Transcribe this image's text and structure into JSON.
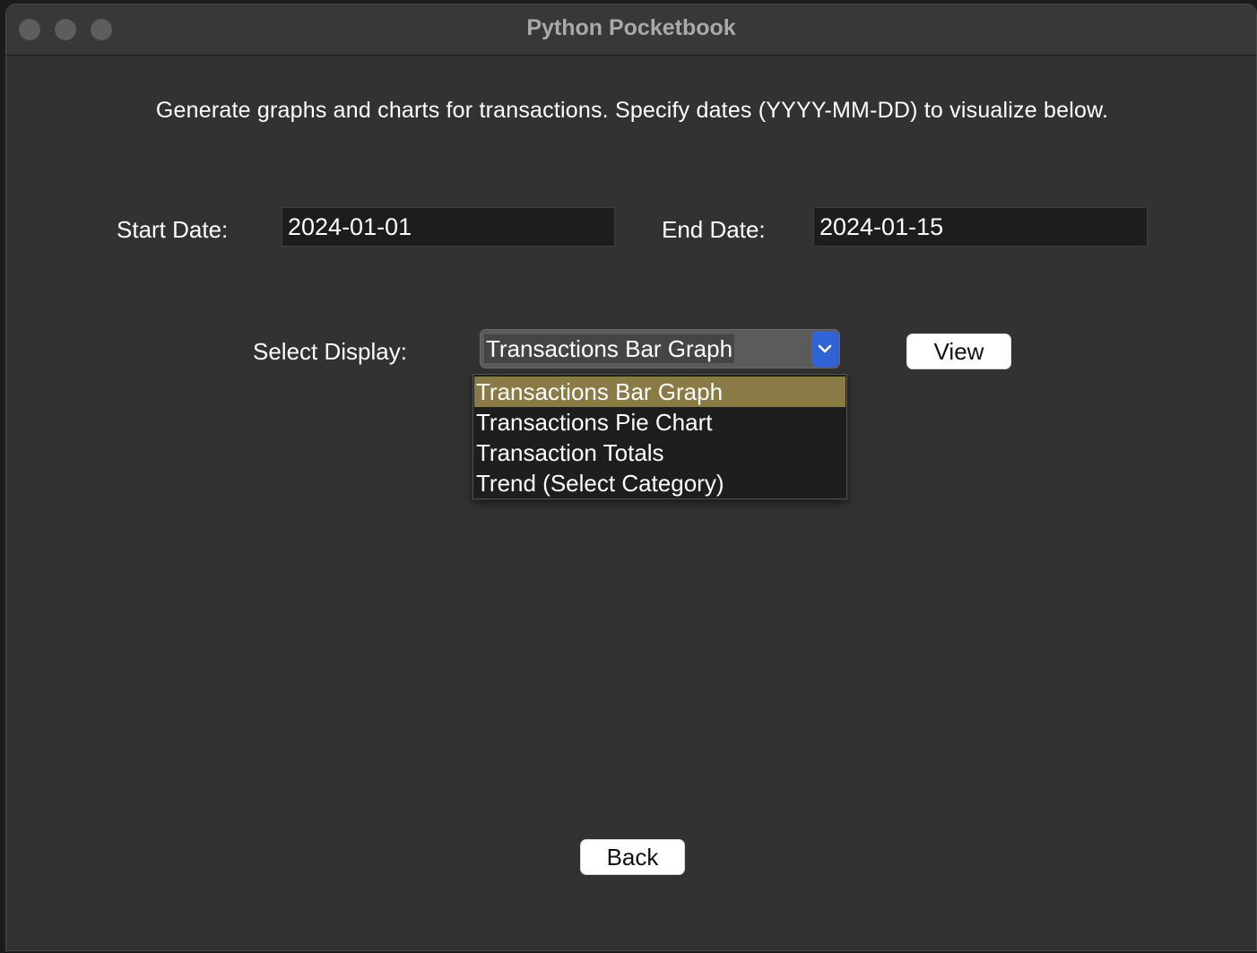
{
  "window": {
    "title": "Python Pocketbook"
  },
  "instructions": "Generate graphs and charts for transactions. Specify dates (YYYY-MM-DD) to visualize below.",
  "dates": {
    "start_label": "Start Date:",
    "start_value": "2024-01-01",
    "end_label": "End Date:",
    "end_value": "2024-01-15"
  },
  "display": {
    "label": "Select Display:",
    "selected": "Transactions Bar Graph",
    "options": [
      "Transactions Bar Graph",
      "Transactions Pie Chart",
      "Transaction Totals",
      "Trend (Select Category)"
    ],
    "highlight_color": "#8a7a45"
  },
  "buttons": {
    "view": "View",
    "back": "Back"
  },
  "colors": {
    "window_bg": "#323232",
    "accent": "#2f63d6"
  }
}
